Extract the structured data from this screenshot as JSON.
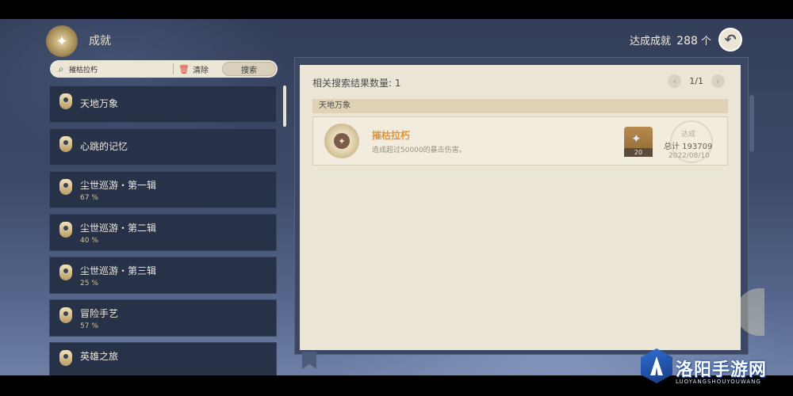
{
  "header": {
    "title": "成就",
    "achieved_label": "达成成就",
    "achieved_count": "288",
    "achieved_unit": "个"
  },
  "search": {
    "value": "摧枯拉朽",
    "clear_label": "清除",
    "search_label": "搜索"
  },
  "categories": [
    {
      "name": "天地万象",
      "progress": ""
    },
    {
      "name": "心跳的记忆",
      "progress": ""
    },
    {
      "name": "尘世巡游・第一辑",
      "progress": "67 %"
    },
    {
      "name": "尘世巡游・第二辑",
      "progress": "40 %"
    },
    {
      "name": "尘世巡游・第三辑",
      "progress": "25 %"
    },
    {
      "name": "冒险手艺",
      "progress": "57 %"
    },
    {
      "name": "英雄之旅",
      "progress": ""
    }
  ],
  "results": {
    "count_label": "相关搜索结果数量: 1",
    "page": "1/1",
    "group": "天地万象",
    "items": [
      {
        "name": "摧枯拉朽",
        "description": "造成超过50000的暴击伤害。",
        "reward_count": "20",
        "status": "达成",
        "total": "总计 193709",
        "date": "2022/08/10"
      }
    ]
  },
  "watermark": {
    "text": "洛阳手游网",
    "sub": "LUOYANGSHOUYOUWANG"
  },
  "icons": {
    "emblem": "achievement-emblem-icon",
    "back": "back-arrow-icon",
    "search": "search-icon",
    "clear": "trash-icon",
    "prev": "chevron-left-icon",
    "next": "chevron-right-icon",
    "reward": "primogem-icon"
  },
  "colors": {
    "accent_orange": "#e29532",
    "panel_bg": "#ebe5d6",
    "list_bg": "#273148"
  }
}
